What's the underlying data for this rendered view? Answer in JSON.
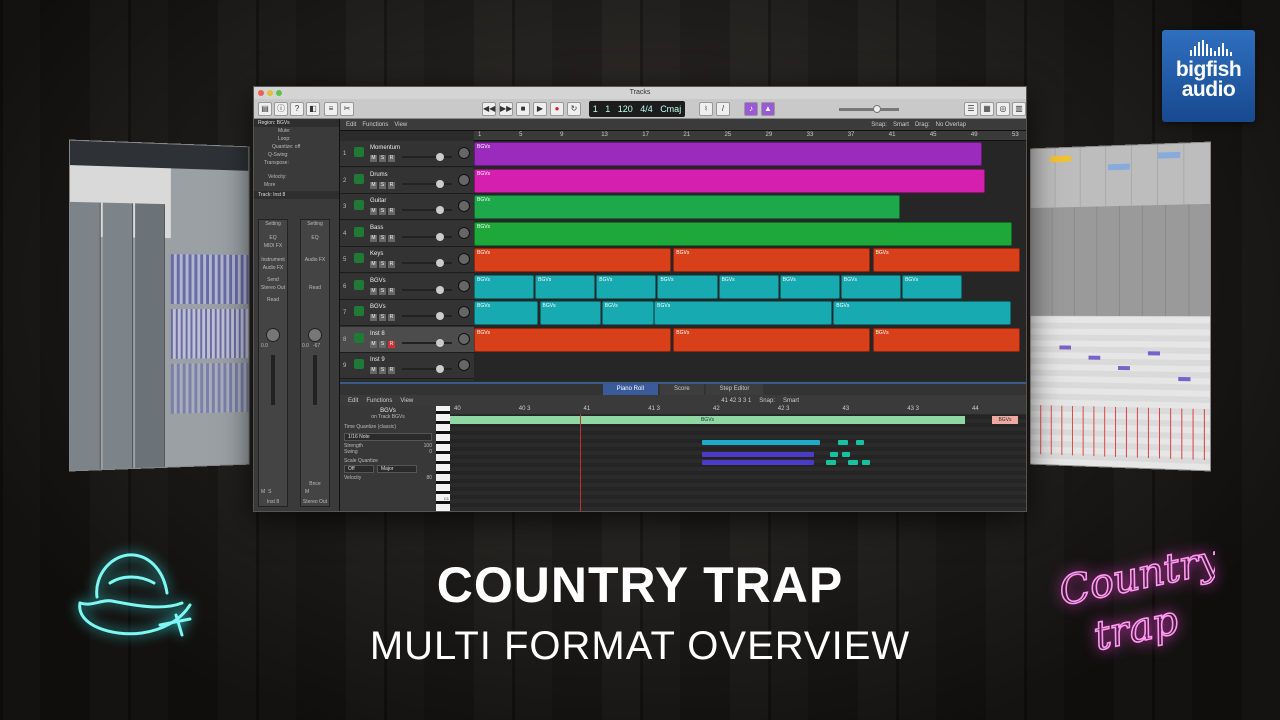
{
  "window": {
    "title": "Tracks"
  },
  "lcd": {
    "bar": "1",
    "beat": "1",
    "tempo": "120",
    "signature": "4/4",
    "key": "Cmaj"
  },
  "inspector": {
    "region_label": "Region: BGVs",
    "rows": [
      "Mute:",
      "Loop:",
      "Quantize: off",
      "Q-Swing:",
      "Transpose:",
      "Velocity:",
      "More"
    ],
    "track_label": "Track: Inst 8",
    "channel_1": {
      "name": "Inst 8",
      "setting": "Setting",
      "eq": "EQ",
      "midi_fx": "MIDI FX",
      "instrument": "Instrument",
      "audio_fx": "Audio FX",
      "send": "Send",
      "output": "Stereo Out",
      "mode": "Read",
      "volume": "0.0",
      "ms": [
        "M",
        "S"
      ]
    },
    "channel_2": {
      "name": "Stereo Out",
      "setting": "Setting",
      "eq": "EQ",
      "audio_fx": "Audio FX",
      "mode": "Read",
      "volume": "0.0",
      "pan": "-67",
      "bnce": "Bnce",
      "ms": [
        "M"
      ]
    }
  },
  "tracks_toolbar": [
    "Edit",
    "Functions",
    "View"
  ],
  "snap": {
    "label": "Snap:",
    "value": "Smart"
  },
  "drag": {
    "label": "Drag:",
    "value": "No Overlap"
  },
  "ruler": [
    "1",
    "5",
    "9",
    "13",
    "17",
    "21",
    "25",
    "29",
    "33",
    "37",
    "41",
    "45",
    "49",
    "53"
  ],
  "tracks": [
    {
      "num": "1",
      "name": "Momentum",
      "color": "#9b2bbd",
      "regions": [
        {
          "label": "BGVs",
          "start": 0,
          "len": 0.93
        }
      ]
    },
    {
      "num": "2",
      "name": "Drums",
      "color": "#d51fae",
      "regions": [
        {
          "label": "BGVs",
          "start": 0,
          "len": 0.935
        }
      ]
    },
    {
      "num": "3",
      "name": "Guitar",
      "color": "#1ea84c",
      "regions": [
        {
          "label": "BGVs",
          "start": 0,
          "len": 0.78
        }
      ]
    },
    {
      "num": "4",
      "name": "Bass",
      "color": "#1ea83a",
      "regions": [
        {
          "label": "BGVs",
          "start": 0,
          "len": 0.985
        }
      ]
    },
    {
      "num": "5",
      "name": "Keys",
      "color": "#d8401a",
      "regions": [
        {
          "label": "BGVs",
          "start": 0,
          "len": 0.36
        },
        {
          "label": "BGVs",
          "start": 0.365,
          "len": 0.36
        },
        {
          "label": "BGVs",
          "start": 0.73,
          "len": 0.27
        }
      ]
    },
    {
      "num": "6",
      "name": "BGVs",
      "color": "#17aab0",
      "regions": [
        {
          "label": "BGVs",
          "start": 0,
          "len": 0.11
        },
        {
          "label": "BGVs",
          "start": 0.112,
          "len": 0.11
        },
        {
          "label": "BGVs",
          "start": 0.224,
          "len": 0.11
        },
        {
          "label": "BGVs",
          "start": 0.336,
          "len": 0.11
        },
        {
          "label": "BGVs",
          "start": 0.448,
          "len": 0.11
        },
        {
          "label": "BGVs",
          "start": 0.56,
          "len": 0.11
        },
        {
          "label": "BGVs",
          "start": 0.672,
          "len": 0.11
        },
        {
          "label": "BGVs",
          "start": 0.784,
          "len": 0.11
        }
      ]
    },
    {
      "num": "7",
      "name": "BGVs",
      "color": "#17aab0",
      "regions": [
        {
          "label": "BGVs",
          "start": 0,
          "len": 0.118
        },
        {
          "label": "BGVs",
          "start": 0.12,
          "len": 0.112
        },
        {
          "label": "BGVs",
          "start": 0.234,
          "len": 0.095
        },
        {
          "label": "BGVs",
          "start": 0.33,
          "len": 0.326
        },
        {
          "label": "BGVs",
          "start": 0.658,
          "len": 0.325
        }
      ]
    },
    {
      "num": "8",
      "name": "Inst 8",
      "color": "#d8401a",
      "regions": [
        {
          "label": "BGVs",
          "start": 0,
          "len": 0.36
        },
        {
          "label": "BGVs",
          "start": 0.365,
          "len": 0.36
        },
        {
          "label": "BGVs",
          "start": 0.73,
          "len": 0.27
        }
      ]
    },
    {
      "num": "9",
      "name": "Inst 9",
      "color": "#555555",
      "regions": []
    }
  ],
  "editor": {
    "tabs": [
      "Piano Roll",
      "Score",
      "Step Editor"
    ],
    "tools": [
      "Edit",
      "Functions",
      "View"
    ],
    "position": "41 42 3 3 1",
    "snap_label": "Snap:",
    "snap_value": "Smart",
    "region_name": "BGVs",
    "region_track": "on Track BGVs",
    "time_quantize": "Time Quantize (classic)",
    "quantize_value": "1/16 Note",
    "strength_label": "Strength",
    "strength_value": "100",
    "swing_label": "Swing",
    "swing_value": "0",
    "scale_quantize": "Scale Quantize",
    "scale_off": "Off",
    "scale_mode": "Major",
    "velocity_label": "Velocity",
    "velocity_value": "80",
    "ruler": [
      "40",
      "40 3",
      "41",
      "41 3",
      "42",
      "42 3",
      "43",
      "43 3",
      "44"
    ],
    "midi_region_label": "BGVs",
    "piano_c_label": "C1"
  },
  "logo": {
    "line1": "bigfish",
    "line2": "audio"
  },
  "title": "COUNTRY TRAP",
  "subtitle": "MULTI FORMAT OVERVIEW",
  "neon_script": {
    "line1": "Country",
    "line2": "trap"
  },
  "colors": {
    "neon_cyan": "#2fe6e6",
    "neon_pink": "#ff3fe0",
    "logo_blue": "#2a63b0"
  }
}
